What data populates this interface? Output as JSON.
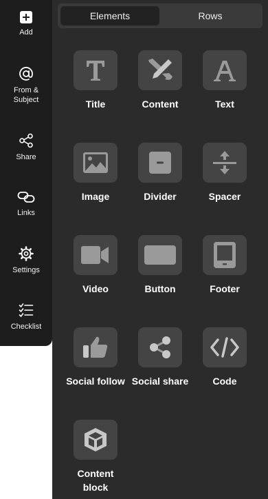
{
  "sidebar": {
    "items": [
      {
        "icon": "add-icon",
        "label": "Add"
      },
      {
        "icon": "at-icon",
        "label": "From & Subject"
      },
      {
        "icon": "share-icon",
        "label": "Share"
      },
      {
        "icon": "link-icon",
        "label": "Links"
      },
      {
        "icon": "gear-icon",
        "label": "Settings"
      },
      {
        "icon": "checklist-icon",
        "label": "Checklist"
      }
    ]
  },
  "tabs": [
    {
      "label": "Elements",
      "active": true
    },
    {
      "label": "Rows",
      "active": false
    }
  ],
  "elements": [
    {
      "label": "Title",
      "icon": "title-icon"
    },
    {
      "label": "Content",
      "icon": "pencil-icon"
    },
    {
      "label": "Text",
      "icon": "text-icon"
    },
    {
      "label": "Image",
      "icon": "image-icon"
    },
    {
      "label": "Divider",
      "icon": "divider-icon"
    },
    {
      "label": "Spacer",
      "icon": "spacer-icon"
    },
    {
      "label": "Video",
      "icon": "video-camera-icon"
    },
    {
      "label": "Button",
      "icon": "button-icon"
    },
    {
      "label": "Footer",
      "icon": "footer-icon"
    },
    {
      "label": "Social follow",
      "icon": "thumbs-up-icon"
    },
    {
      "label": "Social share",
      "icon": "share-nodes-icon"
    },
    {
      "label": "Code",
      "icon": "code-icon"
    },
    {
      "label": "Content block",
      "icon": "cube-icon"
    }
  ],
  "colors": {
    "sidebar_bg": "#1d1d1d",
    "panel_bg": "#2b2b2b",
    "tile_bg": "#444444",
    "icon_fill": "#9a9a9a"
  }
}
